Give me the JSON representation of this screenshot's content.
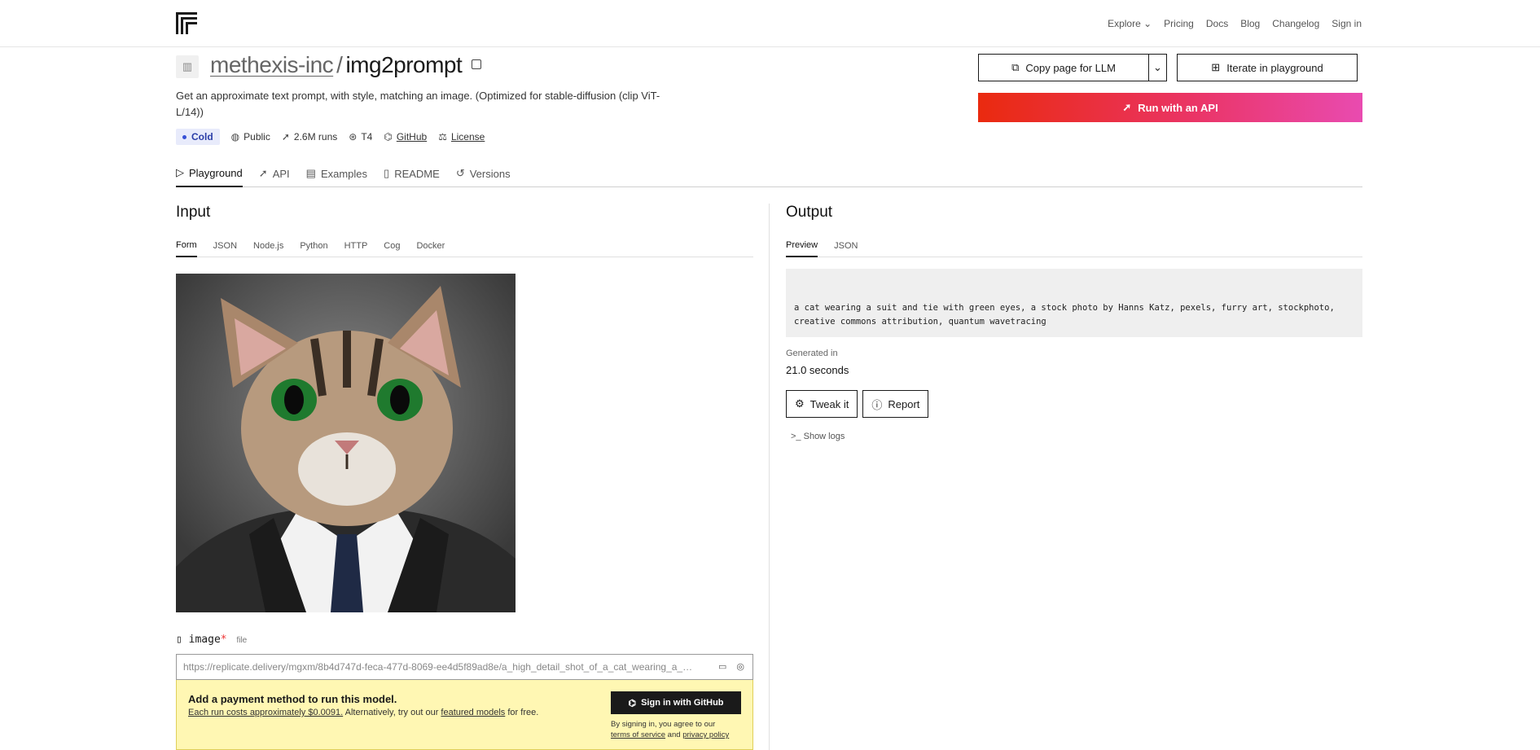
{
  "nav": {
    "logo": "replicate-logo-icon",
    "links": [
      "Explore",
      "Pricing",
      "Docs",
      "Blog",
      "Changelog",
      "Sign in"
    ]
  },
  "model": {
    "org": "methexis-inc",
    "separator": "/",
    "name": "img2prompt",
    "description": "Get an approximate text prompt, with style, matching an image. (Optimized for stable-diffusion (clip ViT-L/14))",
    "status": "Cold",
    "visibility": "Public",
    "runs": "2.6M runs",
    "hardware": "T4",
    "github": "GitHub",
    "license": "License"
  },
  "tabs": [
    "Playground",
    "API",
    "Examples",
    "README",
    "Versions"
  ],
  "actions": {
    "copy_page": "Copy page for LLM",
    "iterate": "Iterate in playground",
    "run_api": "Run with an API"
  },
  "input": {
    "heading": "Input",
    "subtabs": [
      "Form",
      "JSON",
      "Node.js",
      "Python",
      "HTTP",
      "Cog",
      "Docker"
    ],
    "field_name": "image",
    "field_required": "*",
    "field_type": "file",
    "image_url": "https://replicate.delivery/mgxm/8b4d747d-feca-477d-8069-ee4d5f89ad8e/a_high_detail_shot_of_a_cat_wearing_a_suit_realism_8k_-n_9.png",
    "payment": {
      "title": "Add a payment method to run this model.",
      "cost_link": "Each run costs approximately $0.0091.",
      "text_mid": " Alternatively, try out our ",
      "featured_link": "featured models",
      "text_end": " for free.",
      "signin_button": "Sign in with GitHub",
      "terms_prefix": "By signing in, you agree to our",
      "terms_link": "terms of service",
      "terms_and": " and ",
      "privacy_link": "privacy policy"
    }
  },
  "output": {
    "heading": "Output",
    "subtabs": [
      "Preview",
      "JSON"
    ],
    "text": "a cat wearing a suit and tie with green eyes, a stock photo by Hanns Katz, pexels, furry art, stockphoto, creative commons attribution, quantum wavetracing",
    "generated_label": "Generated in",
    "generated_value": "21.0 seconds",
    "tweak_button": "Tweak it",
    "report_button": "Report",
    "show_logs": "Show logs"
  },
  "colors": {
    "run_gradient_start": "#ea2a0f",
    "run_gradient_end": "#e94bb0",
    "cold_badge_bg": "#e8ebfb",
    "payment_bg": "#fff7b3"
  }
}
